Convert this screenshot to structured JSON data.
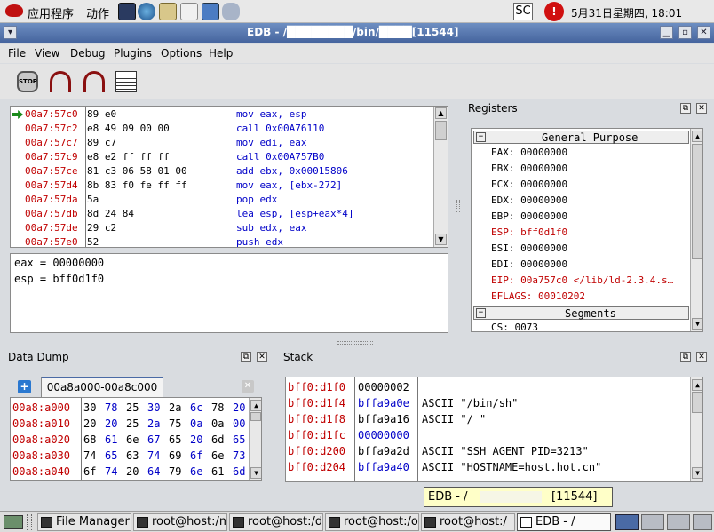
{
  "top_panel": {
    "apps_menu": "应用程序",
    "actions_menu": "动作",
    "input_method": "SC",
    "clock": "5月31日星期四, 18:01",
    "launchers": [
      "terminal-icon",
      "browser-icon",
      "mail-icon",
      "editor-icon",
      "presentation-icon",
      "printer-icon"
    ]
  },
  "window": {
    "title": "EDB - /████████/bin/████[11544]"
  },
  "menu": [
    "File",
    "View",
    "Debug",
    "Plugins",
    "Options",
    "Help"
  ],
  "toolbar": [
    "stop-icon",
    "step-into-icon",
    "step-over-icon",
    "run-icon"
  ],
  "disasm": {
    "rows": [
      {
        "addr": "00a7:57c0",
        "bytes": "89 e0",
        "asm": "mov eax, esp",
        "current": true
      },
      {
        "addr": "00a7:57c2",
        "bytes": "e8 49 09 00 00",
        "asm": "call 0x00A76110"
      },
      {
        "addr": "00a7:57c7",
        "bytes": "89 c7",
        "asm": "mov edi, eax"
      },
      {
        "addr": "00a7:57c9",
        "bytes": "e8 e2 ff ff ff",
        "asm": "call 0x00A757B0"
      },
      {
        "addr": "00a7:57ce",
        "bytes": "81 c3 06 58 01 00",
        "asm": "add ebx, 0x00015806"
      },
      {
        "addr": "00a7:57d4",
        "bytes": "8b 83 f0 fe ff ff",
        "asm": "mov eax, [ebx-272]"
      },
      {
        "addr": "00a7:57da",
        "bytes": "5a",
        "asm": "pop edx"
      },
      {
        "addr": "00a7:57db",
        "bytes": "8d 24 84",
        "asm": "lea esp, [esp+eax*4]"
      },
      {
        "addr": "00a7:57de",
        "bytes": "29 c2",
        "asm": "sub edx, eax"
      },
      {
        "addr": "00a7:57e0",
        "bytes": "52",
        "asm": "push edx"
      }
    ],
    "info": [
      "eax = 00000000",
      "esp = bff0d1f0"
    ]
  },
  "registers": {
    "title": "Registers",
    "group_general": "General Purpose",
    "items": [
      {
        "text": "EAX: 00000000",
        "changed": false
      },
      {
        "text": "EBX: 00000000",
        "changed": false
      },
      {
        "text": "ECX: 00000000",
        "changed": false
      },
      {
        "text": "EDX: 00000000",
        "changed": false
      },
      {
        "text": "EBP: 00000000",
        "changed": false
      },
      {
        "text": "ESP: bff0d1f0",
        "changed": true
      },
      {
        "text": "ESI: 00000000",
        "changed": false
      },
      {
        "text": "EDI: 00000000",
        "changed": false
      },
      {
        "text": "EIP: 00a757c0 </lib/ld-2.3.4.s…",
        "changed": true
      },
      {
        "text": "EFLAGS: 00010202",
        "changed": true
      }
    ],
    "group_segments": "Segments",
    "cs": "CS: 0073"
  },
  "data_dump": {
    "title": "Data Dump",
    "tab": "00a8a000-00a8c000",
    "rows": [
      {
        "addr": "00a8:a000",
        "bytes": [
          "30",
          "78",
          "25",
          "30",
          "2a",
          "6c",
          "78",
          "20"
        ]
      },
      {
        "addr": "00a8:a010",
        "bytes": [
          "20",
          "20",
          "25",
          "2a",
          "75",
          "0a",
          "0a",
          "00"
        ]
      },
      {
        "addr": "00a8:a020",
        "bytes": [
          "68",
          "61",
          "6e",
          "67",
          "65",
          "20",
          "6d",
          "65"
        ]
      },
      {
        "addr": "00a8:a030",
        "bytes": [
          "74",
          "65",
          "63",
          "74",
          "69",
          "6f",
          "6e",
          "73"
        ]
      },
      {
        "addr": "00a8:a040",
        "bytes": [
          "6f",
          "74",
          "20",
          "64",
          "79",
          "6e",
          "61",
          "6d"
        ]
      }
    ]
  },
  "stack": {
    "title": "Stack",
    "rows": [
      {
        "addr": "bff0:d1f0",
        "value": "00000002",
        "value_blue": false,
        "comment": ""
      },
      {
        "addr": "bff0:d1f4",
        "value": "bffa9a0e",
        "value_blue": true,
        "comment": "ASCII \"/bin/sh\""
      },
      {
        "addr": "bff0:d1f8",
        "value": "bffa9a16",
        "value_blue": false,
        "comment": "ASCII \"/                 \""
      },
      {
        "addr": "bff0:d1fc",
        "value": "00000000",
        "value_blue": true,
        "comment": ""
      },
      {
        "addr": "bff0:d200",
        "value": "bffa9a2d",
        "value_blue": false,
        "comment": "ASCII \"SSH_AGENT_PID=3213\""
      },
      {
        "addr": "bff0:d204",
        "value": "bffa9a40",
        "value_blue": true,
        "comment": "ASCII \"HOSTNAME=host.hot.cn\""
      }
    ]
  },
  "tooltip": {
    "left": "EDB - /",
    "right": "[11544]"
  },
  "taskbar": [
    {
      "label": "File Manager (",
      "active": false
    },
    {
      "label": "root@host:/m",
      "active": false
    },
    {
      "label": "root@host:/de",
      "active": false
    },
    {
      "label": "root@host:/ox",
      "active": false
    },
    {
      "label": "root@host:/",
      "active": false
    },
    {
      "label": "EDB - /",
      "active": true
    }
  ],
  "colors": {
    "accent": "#4a6aa5",
    "address": "#c00000",
    "link": "#0000c8"
  }
}
